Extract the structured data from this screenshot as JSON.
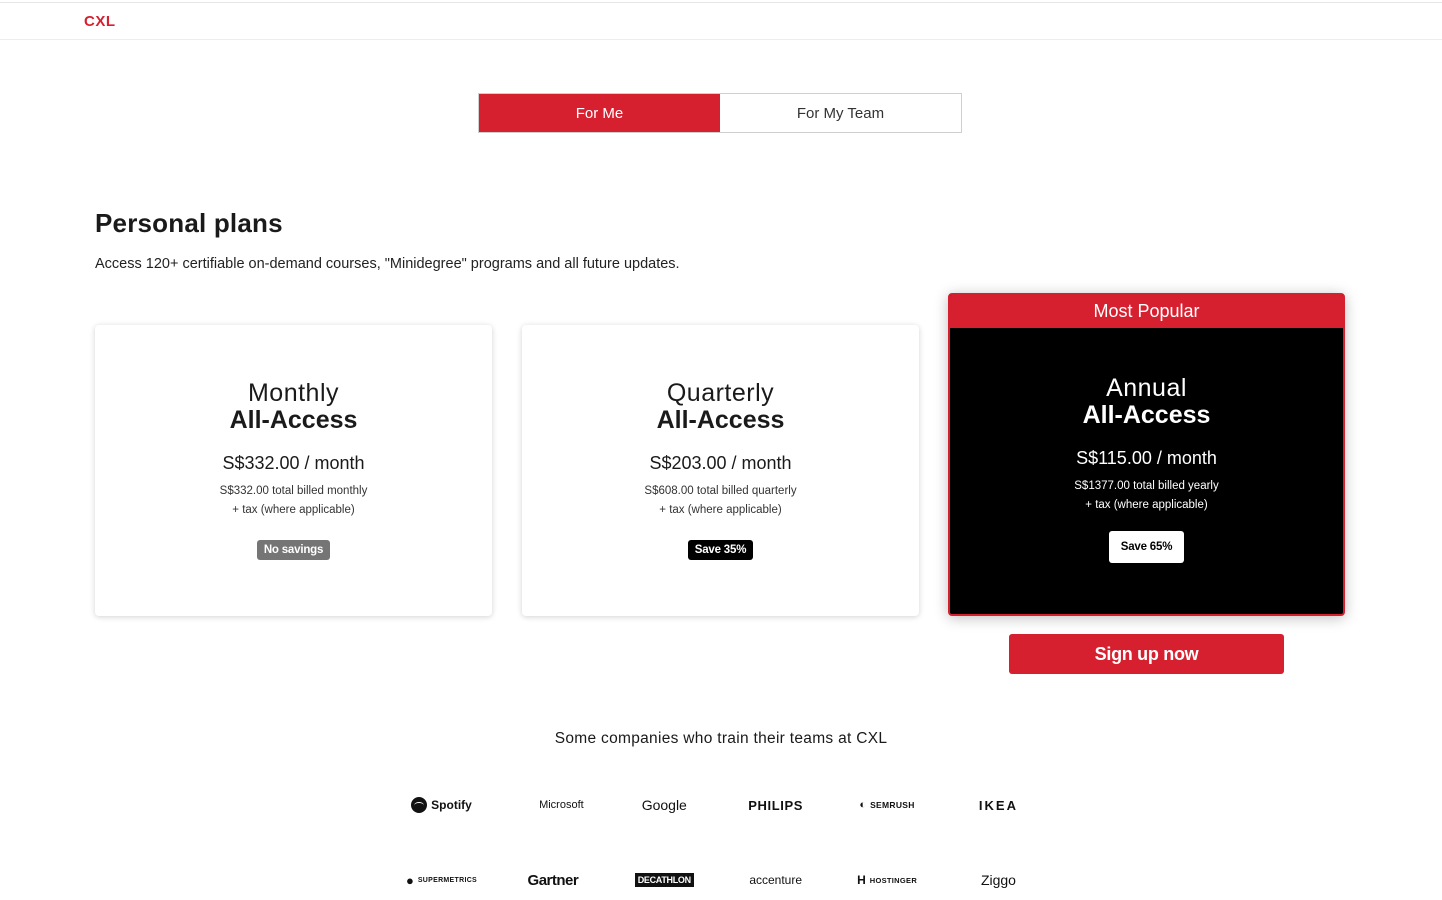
{
  "brand": {
    "logo_text": "CXL",
    "accent_color": "#d7202f"
  },
  "toggle": {
    "for_me": "For Me",
    "for_team": "For My Team",
    "active": "For Me"
  },
  "section": {
    "title": "Personal plans",
    "subtitle": "Access 120+ certifiable on-demand courses, \"Minidegree\" programs and all future updates."
  },
  "plans": [
    {
      "period": "Monthly",
      "tier": "All-Access",
      "price": "S$332.00 / month",
      "billed": "S$332.00 total billed monthly",
      "tax": "+ tax (where applicable)",
      "badge": "No savings"
    },
    {
      "period": "Quarterly",
      "tier": "All-Access",
      "price": "S$203.00 / month",
      "billed": "S$608.00 total billed quarterly",
      "tax": "+ tax (where applicable)",
      "badge": "Save 35%"
    },
    {
      "ribbon": "Most Popular",
      "period": "Annual",
      "tier": "All-Access",
      "price": "S$115.00 / month",
      "billed": "S$1377.00 total billed yearly",
      "tax": "+ tax (where applicable)",
      "badge": "Save 65%"
    }
  ],
  "cta": {
    "signup_label": "Sign up now"
  },
  "companies": {
    "title": "Some companies who train their teams at CXL",
    "row1": [
      {
        "name": "Spotify",
        "icon": "spotify-icon"
      },
      {
        "name": "Microsoft",
        "icon": "microsoft-icon"
      },
      {
        "name": "Google",
        "icon": null
      },
      {
        "name": "PHILIPS",
        "icon": null
      },
      {
        "name": "SEMRUSH",
        "icon": "semrush-icon"
      },
      {
        "name": "IKEA",
        "icon": null
      }
    ],
    "row2": [
      {
        "name": "SUPERMETRICS",
        "icon": "supermetrics-icon"
      },
      {
        "name": "Gartner",
        "icon": null
      },
      {
        "name": "DECATHLON",
        "icon": null
      },
      {
        "name": "accenture",
        "icon": null
      },
      {
        "name": "HOSTINGER",
        "icon": "hostinger-icon"
      },
      {
        "name": "Ziggo",
        "icon": null
      }
    ]
  }
}
